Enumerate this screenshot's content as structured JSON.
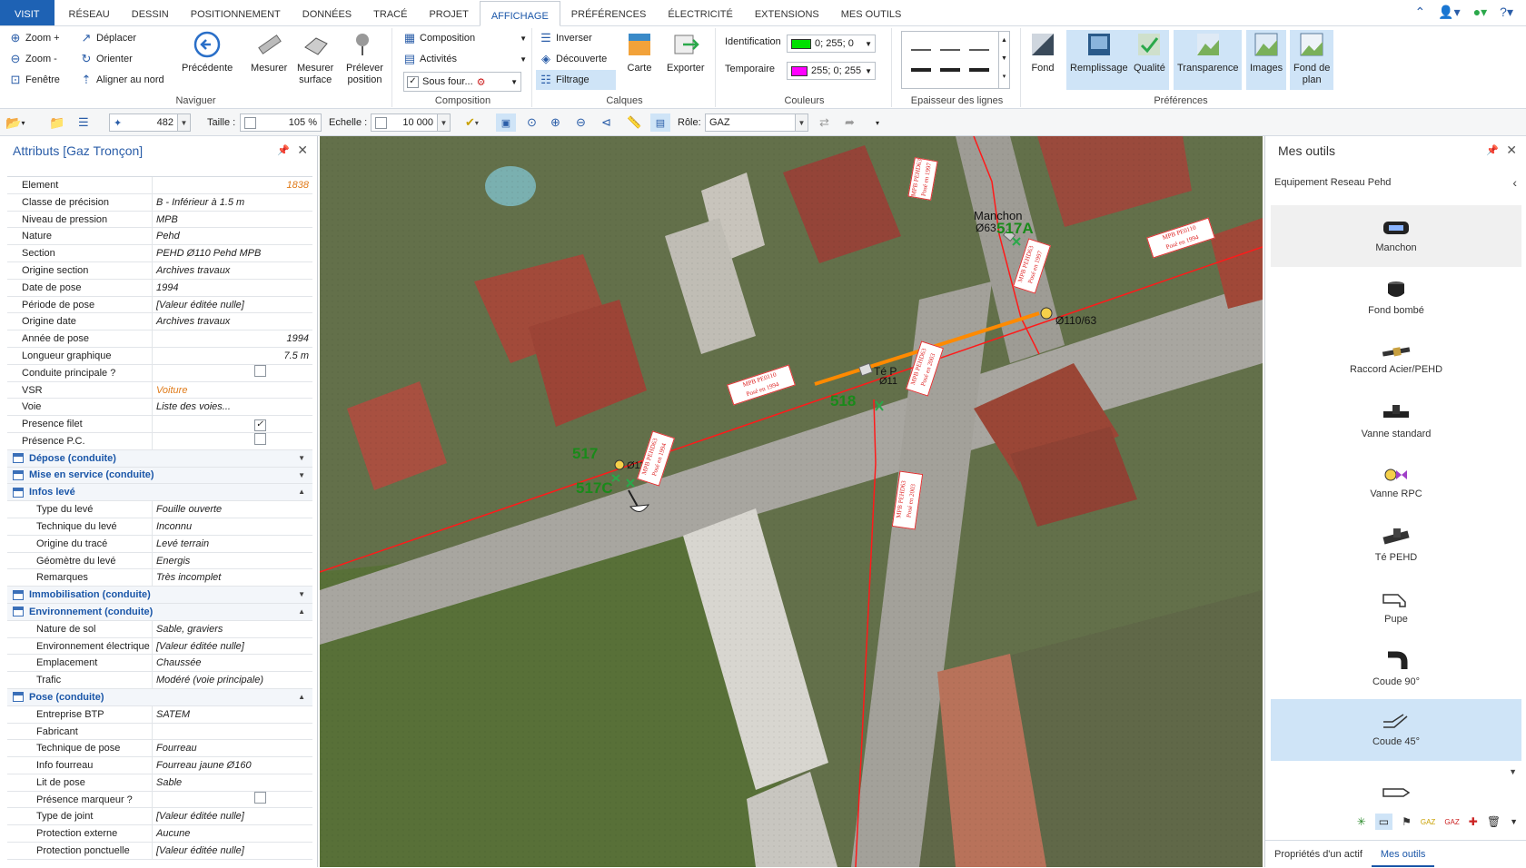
{
  "menu": {
    "tabs": [
      "VISIT",
      "RÉSEAU",
      "DESSIN",
      "POSITIONNEMENT",
      "DONNÉES",
      "TRACÉ",
      "PROJET",
      "AFFICHAGE",
      "PRÉFÉRENCES",
      "ÉLECTRICITÉ",
      "EXTENSIONS",
      "MES OUTILS"
    ],
    "active": "AFFICHAGE"
  },
  "ribbon": {
    "naviguer": {
      "label": "Naviguer",
      "zoom_in": "Zoom +",
      "zoom_out": "Zoom -",
      "fenetre": "Fenêtre",
      "deplacer": "Déplacer",
      "orienter": "Orienter",
      "aligner": "Aligner au nord",
      "precedente": "Précédente",
      "mesurer": "Mesurer",
      "mesurer_surface_1": "Mesurer",
      "mesurer_surface_2": "surface",
      "prelever_1": "Prélever",
      "prelever_2": "position"
    },
    "composition": {
      "label": "Composition",
      "composition": "Composition",
      "activites": "Activités",
      "sous_four": "Sous four..."
    },
    "calques": {
      "label": "Calques",
      "inverser": "Inverser",
      "decouverte": "Découverte",
      "filtrage": "Filtrage",
      "carte": "Carte",
      "exporter": "Exporter"
    },
    "couleurs": {
      "label": "Couleurs",
      "identification": "Identification",
      "identification_value": "0; 255; 0",
      "identification_color": "#00e000",
      "temporaire": "Temporaire",
      "temporaire_value": "255; 0; 255",
      "temporaire_color": "#ff00ff"
    },
    "epaisseur": {
      "label": "Epaisseur des lignes"
    },
    "preferences": {
      "label": "Préférences",
      "fond": "Fond",
      "remplissage": "Remplissage",
      "qualite": "Qualité",
      "transparence": "Transparence",
      "images": "Images",
      "fond_plan_1": "Fond de",
      "fond_plan_2": "plan"
    }
  },
  "toolbar": {
    "count": "482",
    "taille_label": "Taille :",
    "taille_value": "105 %",
    "echelle_label": "Echelle :",
    "echelle_value": "10 000",
    "role_label": "Rôle:",
    "role_value": "GAZ"
  },
  "attributes": {
    "title": "Attributs [Gaz Tronçon]",
    "rows": [
      {
        "k": "Element",
        "v": "1838",
        "style": "or r"
      },
      {
        "k": "Classe de précision",
        "v": "B - Inférieur à 1.5 m"
      },
      {
        "k": "Niveau de pression",
        "v": "MPB"
      },
      {
        "k": "Nature",
        "v": "Pehd"
      },
      {
        "k": "Section",
        "v": "PEHD Ø110 Pehd MPB"
      },
      {
        "k": "Origine section",
        "v": "Archives travaux"
      },
      {
        "k": "Date de pose",
        "v": "1994"
      },
      {
        "k": "Période de pose",
        "v": "[Valeur éditée nulle]"
      },
      {
        "k": "Origine date",
        "v": "Archives travaux"
      },
      {
        "k": "Année de pose",
        "v": "1994",
        "style": "r"
      },
      {
        "k": "Longueur graphique",
        "v": "7.5 m",
        "style": "r"
      },
      {
        "k": "Conduite principale ?",
        "check": false
      },
      {
        "k": "VSR",
        "v": "Voiture",
        "style": "or"
      },
      {
        "k": "Voie",
        "v": "Liste des voies..."
      },
      {
        "k": "Presence filet",
        "check": true
      },
      {
        "k": "Présence P.C.",
        "check": false
      },
      {
        "cat": "Dépose (conduite)",
        "arrow": "▼"
      },
      {
        "cat": "Mise en service (conduite)",
        "arrow": "▼"
      },
      {
        "cat": "Infos levé",
        "arrow": "▲"
      },
      {
        "k": "Type du levé",
        "v": "Fouille ouverte",
        "sub": true
      },
      {
        "k": "Technique du levé",
        "v": "Inconnu",
        "sub": true
      },
      {
        "k": "Origine du tracé",
        "v": "Levé terrain",
        "sub": true
      },
      {
        "k": "Géomètre du levé",
        "v": "Energis",
        "sub": true
      },
      {
        "k": "Remarques",
        "v": "Très incomplet",
        "sub": true
      },
      {
        "cat": "Immobilisation (conduite)",
        "arrow": "▼"
      },
      {
        "cat": "Environnement (conduite)",
        "arrow": "▲"
      },
      {
        "k": "Nature de sol",
        "v": "Sable, graviers",
        "sub": true
      },
      {
        "k": "Environnement électrique",
        "v": "[Valeur éditée nulle]",
        "sub": true
      },
      {
        "k": "Emplacement",
        "v": "Chaussée",
        "sub": true
      },
      {
        "k": "Trafic",
        "v": "Modéré (voie principale)",
        "sub": true
      },
      {
        "cat": "Pose (conduite)",
        "arrow": "▲"
      },
      {
        "k": "Entreprise BTP",
        "v": "SATEM",
        "sub": true
      },
      {
        "k": "Fabricant",
        "v": "",
        "sub": true
      },
      {
        "k": "Technique de pose",
        "v": "Fourreau",
        "sub": true
      },
      {
        "k": "Info fourreau",
        "v": "Fourreau jaune Ø160",
        "sub": true
      },
      {
        "k": "Lit de pose",
        "v": "Sable",
        "sub": true
      },
      {
        "k": "Présence marqueur ?",
        "check": false,
        "sub": true
      },
      {
        "k": "Type de joint",
        "v": "[Valeur éditée nulle]",
        "sub": true
      },
      {
        "k": "Protection externe",
        "v": "Aucune",
        "sub": true
      },
      {
        "k": "Protection ponctuelle",
        "v": "[Valeur éditée nulle]",
        "sub": true
      }
    ]
  },
  "map": {
    "labels": {
      "manchon": "Manchon",
      "d63": "Ø63",
      "n517A": "517A",
      "d110_63": "Ø110/63",
      "te": "Té P",
      "d11": "Ø11",
      "n518": "518",
      "n517": "517",
      "d110": "Ø110/",
      "n517C": "517C"
    },
    "tags": [
      {
        "l1": "MPB PEHD63",
        "l2": "Posé en 1997"
      },
      {
        "l1": "MPB PE0110",
        "l2": "Posé en 1994"
      },
      {
        "l1": "MPB PEHD63",
        "l2": "Posé en 1997"
      },
      {
        "l1": "MPB PE0110",
        "l2": "Posé en 1994"
      },
      {
        "l1": "MPB PEHD63",
        "l2": "Posé en 2003"
      },
      {
        "l1": "MPB PEHD63",
        "l2": "Posé en 1994"
      },
      {
        "l1": "MPB PEHD63",
        "l2": "Posé en 2003"
      }
    ],
    "colors": {
      "pipe": "#ff1a1a",
      "selected": "#ff8a00",
      "labels_green": "#1a8a1a"
    }
  },
  "tools": {
    "title": "Mes outils",
    "subtitle": "Equipement Reseau Pehd",
    "items": [
      "Manchon",
      "Fond bombé",
      "Raccord Acier/PEHD",
      "Vanne standard",
      "Vanne RPC",
      "Té PEHD",
      "Pupe",
      "Coude 90°",
      "Coude 45°"
    ],
    "tabs": [
      "Propriétés d'un actif",
      "Mes outils"
    ]
  }
}
